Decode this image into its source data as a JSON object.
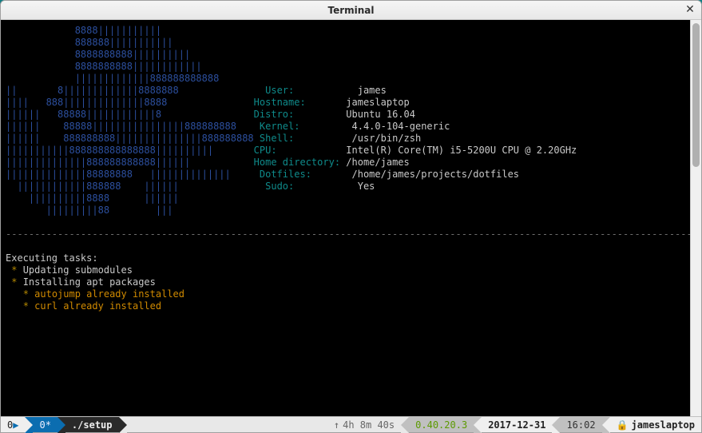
{
  "window": {
    "title": "Terminal"
  },
  "ascii": [
    "            8888|||||||||||",
    "            888888|||||||||||",
    "            8888888888||||||||||",
    "            8888888888||||||||||||",
    "            |||||||||||||888888888888",
    "||       8|||||||||||||8888888",
    "||||   888||||||||||||||8888",
    "||||||   88888||||||||||||8",
    "||||||    88888||||||||||||||||888888888",
    "||||||    888888888|||||||||||||||888888888",
    "|||||||||||888888888888888||||||||||",
    "||||||||||||||888888888888||||||",
    "||||||||||||||88888888   ||||||||||||||",
    "  ||||||||||||888888    ||||||",
    "    ||||||||||8888      ||||||",
    "       |||||||||88        |||"
  ],
  "info": {
    "User": "james",
    "Hostname": "jameslaptop",
    "Distro": "Ubuntu 16.04",
    "Kernel": "4.4.0-104-generic",
    "Shell": "/usr/bin/zsh",
    "CPU": "Intel(R) Core(TM) i5-5200U CPU @ 2.20GHz",
    "Home directory": "/home/james",
    "Dotfiles": "/home/james/projects/dotfiles",
    "Sudo": "Yes"
  },
  "divider_char": "-",
  "exec_header": "Executing tasks:",
  "tasks": {
    "t1": "Updating submodules",
    "t2": "Installing apt packages",
    "t2a": "autojump already installed",
    "t2b": "curl already installed"
  },
  "status": {
    "left_index": "0",
    "left_tab": "0*",
    "left_cmd": "./setup",
    "uptime": "4h 8m 40s",
    "load1": "0.4",
    "load2": "0.2",
    "load3": "0.3",
    "date": "2017-12-31",
    "time": "16:02",
    "host": "jameslaptop"
  }
}
